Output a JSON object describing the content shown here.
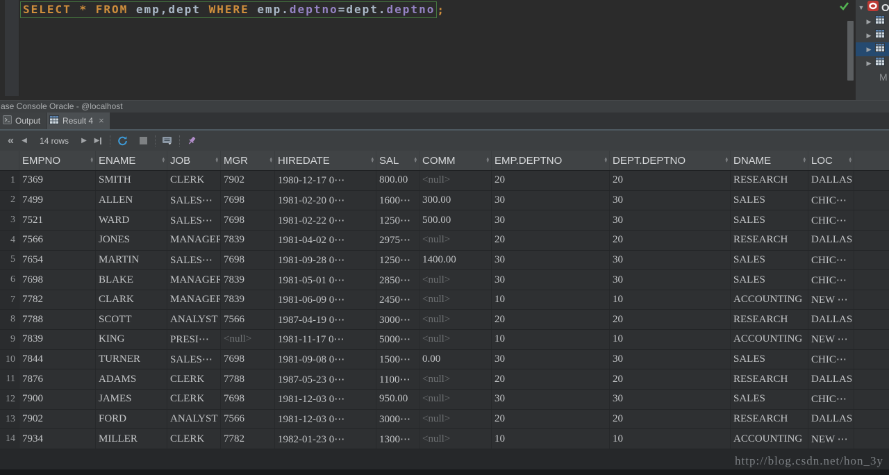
{
  "editor": {
    "sql_tokens": [
      {
        "text": "SELECT ",
        "type": "keyword"
      },
      {
        "text": "* ",
        "type": "keyword"
      },
      {
        "text": "FROM ",
        "type": "keyword"
      },
      {
        "text": "emp,dept ",
        "type": "plain"
      },
      {
        "text": "WHERE ",
        "type": "keyword"
      },
      {
        "text": "emp",
        "type": "plain"
      },
      {
        "text": ".",
        "type": "plain"
      },
      {
        "text": "deptno",
        "type": "field"
      },
      {
        "text": "=",
        "type": "plain"
      },
      {
        "text": "dept",
        "type": "plain"
      },
      {
        "text": ".",
        "type": "plain"
      },
      {
        "text": "deptno",
        "type": "field"
      }
    ],
    "semicolon": ";"
  },
  "console": {
    "title": "ase Console Oracle - @localhost"
  },
  "tabs": {
    "output": "Output",
    "result": "Result 4"
  },
  "toolbar": {
    "rows_count": "14 rows"
  },
  "side_tree": {
    "root_label": "O",
    "partial_item_label": "M"
  },
  "grid": {
    "columns": [
      "EMPNO",
      "ENAME",
      "JOB",
      "MGR",
      "HIREDATE",
      "SAL",
      "COMM",
      "EMP.DEPTNO",
      "DEPT.DEPTNO",
      "DNAME",
      "LOC"
    ],
    "rows": [
      [
        "7369",
        "SMITH",
        "CLERK",
        "7902",
        "1980-12-17 0⋯",
        "800.00",
        "<null>",
        "20",
        "20",
        "RESEARCH",
        "DALLAS"
      ],
      [
        "7499",
        "ALLEN",
        "SALES⋯",
        "7698",
        "1981-02-20 0⋯",
        "1600⋯",
        "300.00",
        "30",
        "30",
        "SALES",
        "CHIC⋯"
      ],
      [
        "7521",
        "WARD",
        "SALES⋯",
        "7698",
        "1981-02-22 0⋯",
        "1250⋯",
        "500.00",
        "30",
        "30",
        "SALES",
        "CHIC⋯"
      ],
      [
        "7566",
        "JONES",
        "MANAGER",
        "7839",
        "1981-04-02 0⋯",
        "2975⋯",
        "<null>",
        "20",
        "20",
        "RESEARCH",
        "DALLAS"
      ],
      [
        "7654",
        "MARTIN",
        "SALES⋯",
        "7698",
        "1981-09-28 0⋯",
        "1250⋯",
        "1400.00",
        "30",
        "30",
        "SALES",
        "CHIC⋯"
      ],
      [
        "7698",
        "BLAKE",
        "MANAGER",
        "7839",
        "1981-05-01 0⋯",
        "2850⋯",
        "<null>",
        "30",
        "30",
        "SALES",
        "CHIC⋯"
      ],
      [
        "7782",
        "CLARK",
        "MANAGER",
        "7839",
        "1981-06-09 0⋯",
        "2450⋯",
        "<null>",
        "10",
        "10",
        "ACCOUNTING",
        "NEW ⋯"
      ],
      [
        "7788",
        "SCOTT",
        "ANALYST",
        "7566",
        "1987-04-19 0⋯",
        "3000⋯",
        "<null>",
        "20",
        "20",
        "RESEARCH",
        "DALLAS"
      ],
      [
        "7839",
        "KING",
        "PRESI⋯",
        "<null>",
        "1981-11-17 0⋯",
        "5000⋯",
        "<null>",
        "10",
        "10",
        "ACCOUNTING",
        "NEW ⋯"
      ],
      [
        "7844",
        "TURNER",
        "SALES⋯",
        "7698",
        "1981-09-08 0⋯",
        "1500⋯",
        "0.00",
        "30",
        "30",
        "SALES",
        "CHIC⋯"
      ],
      [
        "7876",
        "ADAMS",
        "CLERK",
        "7788",
        "1987-05-23 0⋯",
        "1100⋯",
        "<null>",
        "20",
        "20",
        "RESEARCH",
        "DALLAS"
      ],
      [
        "7900",
        "JAMES",
        "CLERK",
        "7698",
        "1981-12-03 0⋯",
        "950.00",
        "<null>",
        "30",
        "30",
        "SALES",
        "CHIC⋯"
      ],
      [
        "7902",
        "FORD",
        "ANALYST",
        "7566",
        "1981-12-03 0⋯",
        "3000⋯",
        "<null>",
        "20",
        "20",
        "RESEARCH",
        "DALLAS"
      ],
      [
        "7934",
        "MILLER",
        "CLERK",
        "7782",
        "1982-01-23 0⋯",
        "1300⋯",
        "<null>",
        "10",
        "10",
        "ACCOUNTING",
        "NEW ⋯"
      ]
    ],
    "null_token": "<null>"
  },
  "watermark": "http://blog.csdn.net/hon_3y",
  "icons": {
    "first_page": "«",
    "prev_page": "◀",
    "next_page": "▶",
    "close": "×",
    "sort_up": "▴",
    "sort_down": "▾",
    "tree_expanded": "▼",
    "tree_collapsed": "▶"
  },
  "colors": {
    "keyword_orange": "#CF8E3C",
    "field_purple": "#9583C4",
    "statement_border_green": "#44753E",
    "selection_blue": "#254A70",
    "oracle_red": "#BE3A34",
    "reload_blue": "#3D9BD9",
    "pin_purple": "#B08CC8",
    "null_gray": "#6F7274"
  }
}
